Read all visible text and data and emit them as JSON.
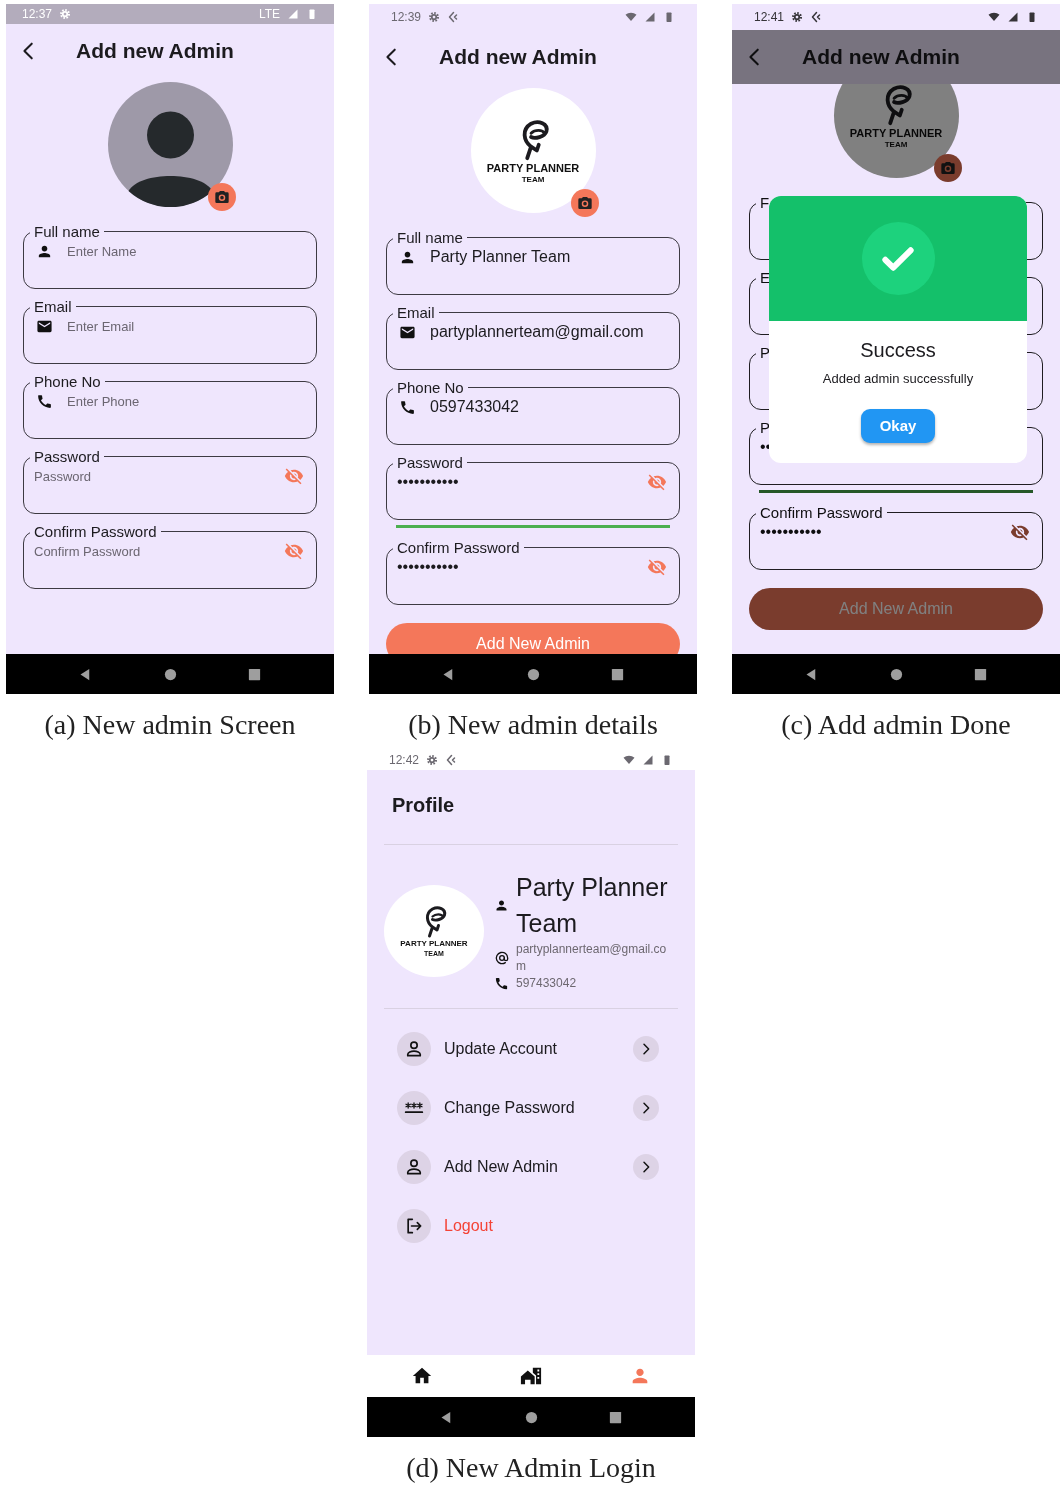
{
  "figures": [
    {
      "caption": "(a) New admin Screen",
      "screen": {
        "kind": "form",
        "dimmed": false,
        "status_bar": {
          "time": "12:37",
          "network": "LTE"
        },
        "title": "Add new Admin",
        "avatar": {
          "kind": "silhouette"
        },
        "fields": [
          {
            "kind": "text",
            "label": "Full name",
            "placeholder": "Enter Name"
          },
          {
            "kind": "text",
            "label": "Email",
            "placeholder": "Enter Email"
          },
          {
            "kind": "text",
            "label": "Phone No",
            "placeholder": "Enter Phone"
          },
          {
            "kind": "password",
            "label": "Password",
            "placeholder": "Password"
          },
          {
            "kind": "password",
            "label": "Confirm Password",
            "placeholder": "Confirm Password"
          }
        ]
      }
    },
    {
      "caption": "(b) New admin details",
      "screen": {
        "kind": "form",
        "dimmed": false,
        "status_bar": {
          "time": "12:39"
        },
        "title": "Add new Admin",
        "avatar": {
          "kind": "logo",
          "text": "PARTY PLANNER",
          "subtext": "TEAM"
        },
        "fields": [
          {
            "kind": "text",
            "label": "Full name",
            "value": "Party Planner Team"
          },
          {
            "kind": "text",
            "label": "Email",
            "value": "partyplannerteam@gmail.com"
          },
          {
            "kind": "text",
            "label": "Phone No",
            "value": "0597433042"
          },
          {
            "kind": "password",
            "label": "Password",
            "value": "•••••••••••",
            "strong_password": true
          },
          {
            "kind": "password",
            "label": "Confirm Password",
            "value": "•••••••••••"
          }
        ],
        "button": "Add New Admin"
      }
    },
    {
      "caption": "(c) Add admin Done",
      "screen": {
        "kind": "form",
        "dimmed": true,
        "status_bar": {
          "time": "12:41"
        },
        "title": "Add new Admin",
        "avatar": {
          "kind": "logo",
          "text": "PARTY PLANNER",
          "subtext": "TEAM"
        },
        "fields": [
          {
            "kind": "text",
            "label": "F"
          },
          {
            "kind": "text",
            "label": "E"
          },
          {
            "kind": "text",
            "label": "P"
          },
          {
            "kind": "text",
            "label": "P",
            "value": "••",
            "strong_password": true
          },
          {
            "kind": "password",
            "label": "Confirm Password",
            "value": "•••••••••••"
          }
        ],
        "button": "Add New Admin",
        "dialog": {
          "title": "Success",
          "message": "Added admin successfully",
          "button": "Okay"
        }
      }
    },
    {
      "caption": "(d) New Admin Login",
      "screen": {
        "kind": "profile",
        "status_bar": {
          "time": "12:42"
        },
        "title": "Profile",
        "profile": {
          "avatar": {
            "kind": "logo",
            "text": "PARTY PLANNER",
            "subtext": "TEAM"
          },
          "name": "Party Planner Team",
          "email": "partyplannerteam@gmail.com",
          "phone": "597433042"
        },
        "menu": [
          {
            "label": "Update Account",
            "chevron": true,
            "danger": false
          },
          {
            "label": "Change Password",
            "chevron": true,
            "danger": false
          },
          {
            "label": "Add New Admin",
            "chevron": true,
            "danger": false
          },
          {
            "label": "Logout",
            "chevron": false,
            "danger": true
          }
        ],
        "bottom_nav": [
          {
            "selected": false
          },
          {
            "selected": false
          },
          {
            "selected": true
          }
        ]
      }
    }
  ]
}
